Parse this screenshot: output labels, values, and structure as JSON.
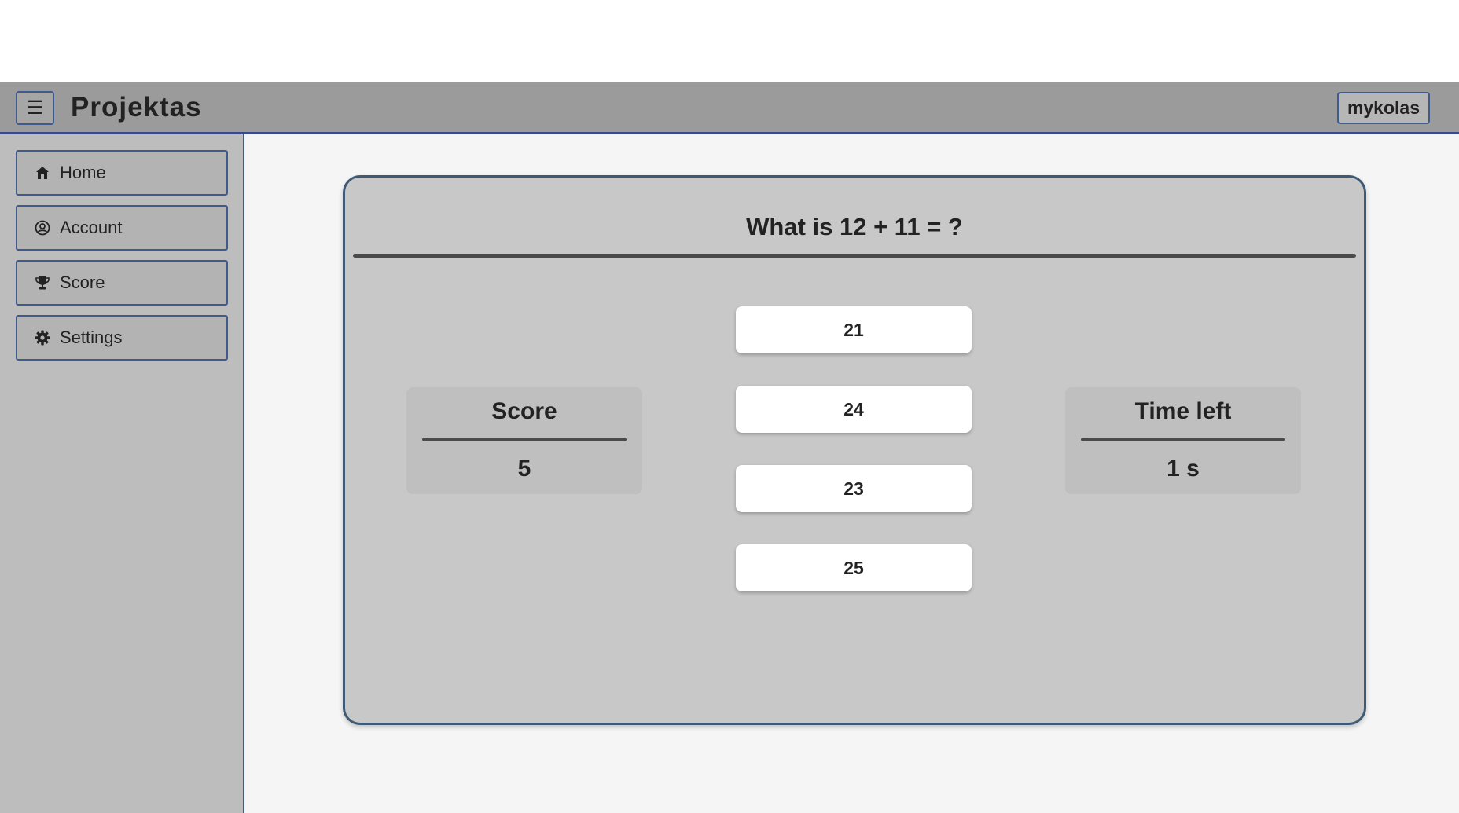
{
  "navbar": {
    "menu_icon": "☰",
    "brand": "Projektas",
    "user": "mykolas"
  },
  "sidebar": {
    "items": [
      {
        "label": "Home",
        "icon": "home-icon"
      },
      {
        "label": "Account",
        "icon": "user-circle-icon"
      },
      {
        "label": "Score",
        "icon": "trophy-icon"
      },
      {
        "label": "Settings",
        "icon": "gear-icon"
      }
    ]
  },
  "quiz": {
    "question": "What is 12 + 11 = ?",
    "answers": [
      "21",
      "24",
      "23",
      "25"
    ],
    "score": {
      "title": "Score",
      "value": "5"
    },
    "time": {
      "title": "Time left",
      "value": "1 s"
    }
  },
  "colors": {
    "accent_border": "#3f5a8c",
    "navbar_bg": "#9b9b9b",
    "sidebar_bg": "#bdbdbd",
    "card_bg": "#c8c8c8",
    "main_bg": "#f5f5f5"
  }
}
